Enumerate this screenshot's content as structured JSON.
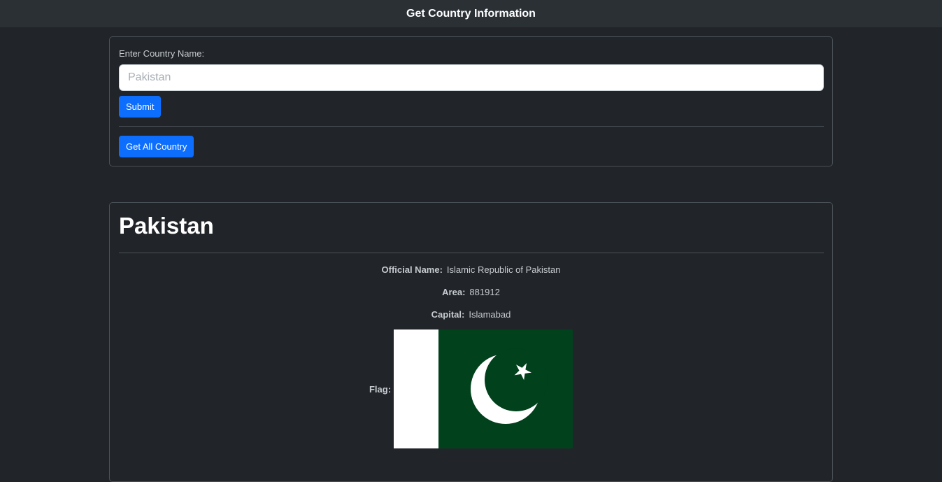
{
  "header": {
    "title": "Get Country Information"
  },
  "search": {
    "label": "Enter Country Name:",
    "placeholder": "Pakistan",
    "value": "",
    "submit_label": "Submit",
    "get_all_label": "Get All Country"
  },
  "result": {
    "name": "Pakistan",
    "official_name_label": "Official Name:",
    "official_name": "Islamic Republic of Pakistan",
    "area_label": "Area:",
    "area": "881912",
    "capital_label": "Capital:",
    "capital": "Islamabad",
    "flag_label": "Flag:",
    "flag_icon": "pakistan-flag",
    "flag_colors": {
      "green": "#01411c",
      "white": "#ffffff"
    }
  },
  "theme": {
    "background": "#212529",
    "header_bg": "#2b3035",
    "accent": "#0d6efd"
  }
}
